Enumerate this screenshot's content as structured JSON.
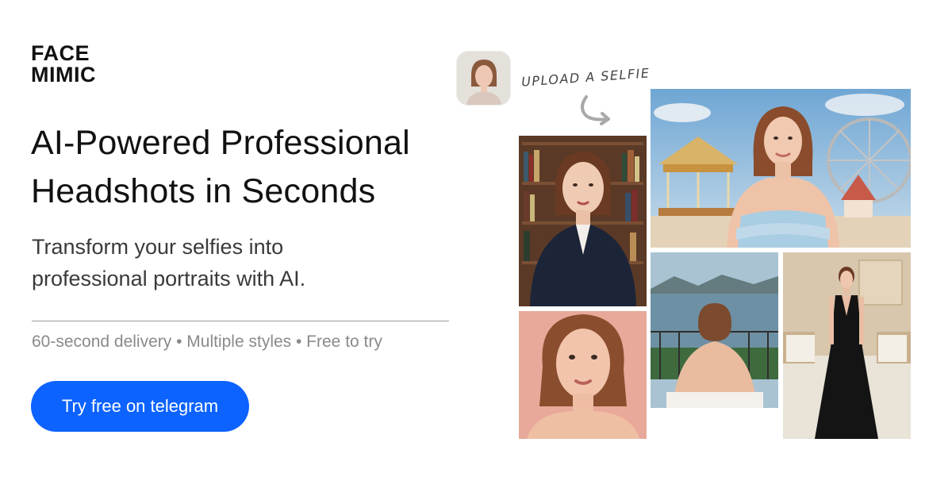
{
  "brand": {
    "line1": "FACE",
    "line2": "MIMIC"
  },
  "hero": {
    "headline_line1": "AI-Powered Professional",
    "headline_line2": "Headshots in Seconds",
    "subhead_line1": "Transform your selfies into",
    "subhead_line2": "professional portraits with AI.",
    "features": "60-second delivery • Multiple styles • Free to try"
  },
  "cta": {
    "label": "Try free on telegram",
    "color": "#0c63ff"
  },
  "collage": {
    "upload_label": "UPLOAD A SELFIE",
    "tiles": [
      "office-portrait",
      "pink-backdrop-portrait",
      "fairground-portrait",
      "seaside-balcony-portrait",
      "bedroom-black-dress-portrait"
    ]
  }
}
